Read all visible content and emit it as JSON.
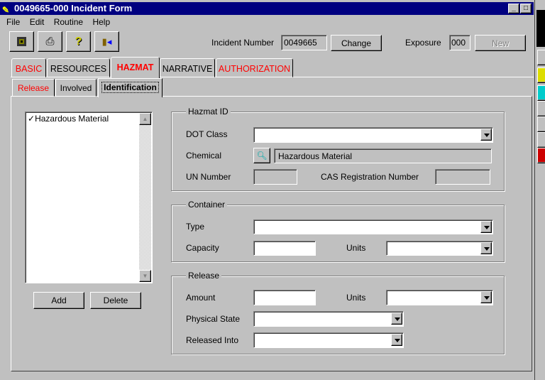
{
  "window": {
    "title": "0049665-000 Incident Form"
  },
  "menu": [
    "File",
    "Edit",
    "Routine",
    "Help"
  ],
  "toolbar": {
    "icons": [
      "save-icon",
      "print-icon",
      "help-icon",
      "exit-icon"
    ]
  },
  "header": {
    "incident_label": "Incident Number",
    "incident_value": "0049665",
    "change_label": "Change",
    "exposure_label": "Exposure",
    "exposure_value": "000",
    "new_label": "New"
  },
  "tabs": [
    "BASIC",
    "RESOURCES",
    "HAZMAT",
    "NARRATIVE",
    "AUTHORIZATION"
  ],
  "subtabs": [
    "Release",
    "Involved",
    "Identification"
  ],
  "list": {
    "items": [
      "Hazardous Material"
    ],
    "add_label": "Add",
    "delete_label": "Delete"
  },
  "hazmat_id": {
    "legend": "Hazmat ID",
    "dot_class_label": "DOT Class",
    "dot_class_value": "",
    "chemical_label": "Chemical",
    "chemical_value": "Hazardous Material",
    "un_label": "UN Number",
    "un_value": "",
    "cas_label": "CAS Registration Number",
    "cas_value": ""
  },
  "container": {
    "legend": "Container",
    "type_label": "Type",
    "capacity_label": "Capacity",
    "units_label": "Units"
  },
  "release": {
    "legend": "Release",
    "amount_label": "Amount",
    "units_label": "Units",
    "state_label": "Physical State",
    "into_label": "Released Into"
  },
  "colors": {
    "title": "#000080",
    "accent_tab": "#ff0000"
  }
}
